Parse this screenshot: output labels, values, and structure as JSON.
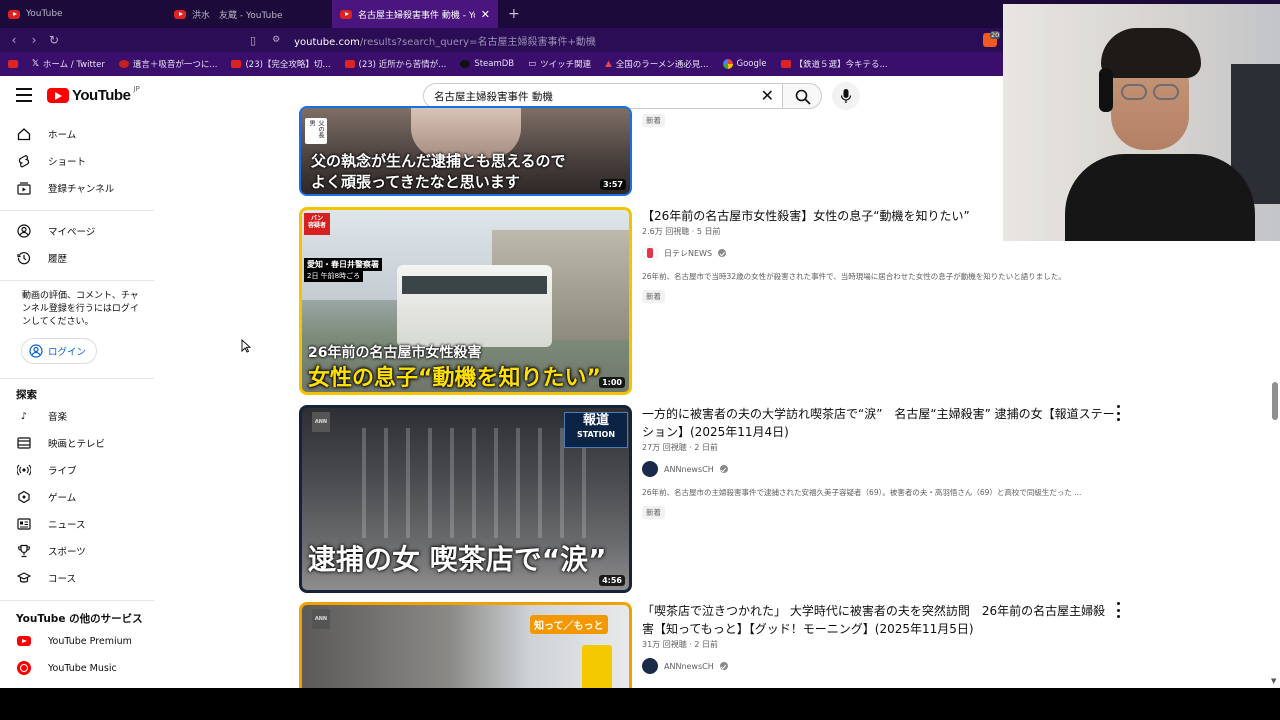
{
  "browser": {
    "tabs": [
      {
        "title": "YouTube",
        "active": false
      },
      {
        "title": "洪水　友蔵 - YouTube",
        "active": false
      },
      {
        "title": "名古屋主婦殺害事件 動機 - YouT",
        "active": true
      }
    ],
    "url_host": "youtube.com",
    "url_path": "/results?search_query=名古屋主婦殺害事件+動機",
    "bookmarks": [
      "ホーム / Twitter",
      "遺言＋吸音が一つに...",
      "(23)【完全攻略】切...",
      "(23) 近所から苦情が...",
      "SteamDB",
      "ツイッチ関連",
      "全国のラーメン通必見...",
      "Google",
      "【鉄道５選】今キテる..."
    ],
    "shield_count": "20"
  },
  "youtube": {
    "logo_text": "YouTube",
    "logo_region": "JP",
    "search_value": "名古屋主婦殺害事件 動機"
  },
  "sidebar": {
    "main": [
      "ホーム",
      "ショート",
      "登録チャンネル"
    ],
    "you": [
      "マイページ",
      "履歴"
    ],
    "login_note": "動画の評価、コメント、チャンネル登録を行うにはログインしてください。",
    "login_label": "ログイン",
    "explore_heading": "探索",
    "explore": [
      "音楽",
      "映画とテレビ",
      "ライブ",
      "ゲーム",
      "ニュース",
      "スポーツ",
      "コース"
    ],
    "more_heading": "YouTube の他のサービス",
    "more": [
      "YouTube Premium",
      "YouTube Music"
    ]
  },
  "results": [
    {
      "duration": "3:57",
      "thumb_caption_small": "父の長男",
      "thumb_caption_1": "父の執念が生んだ逮捕とも思えるので",
      "thumb_caption_2": "よく頑張ってきたなと思います",
      "badge": "新着"
    },
    {
      "title": "【26年前の名古屋市女性殺害】女性の息子“動機を知りたい”",
      "views": "2.6万 回視聴",
      "age": "5 日前",
      "channel": "日テレNEWS",
      "description": "26年前、名古屋市で当時32歳の女性が殺害された事件で、当時現場に居合わせた女性の息子が動機を知りたいと語りました。",
      "badge": "新着",
      "duration": "1:00",
      "thumb_tag": "バン\n容疑者",
      "thumb_place": "愛知・春日井警察署",
      "thumb_time": "2日 午前8時ごろ",
      "thumb_headline_1": "26年前の名古屋市女性殺害",
      "thumb_headline_2": "女性の息子“動機を知りたい”"
    },
    {
      "title": "一方的に被害者の夫の大学訪れ喫茶店で“涙”　名古屋“主婦殺害” 逮捕の女【報道ステーション】(2025年11月4日)",
      "views": "27万 回視聴",
      "age": "2 日前",
      "channel": "ANNnewsCH",
      "description": "26年前、名古屋市の主婦殺害事件で逮捕された安福久美子容疑者（69）。被害者の夫・高羽悟さん（69）と高校で同級生だった ...",
      "badge": "新着",
      "duration": "4:56",
      "thumb_logo_1": "報道",
      "thumb_logo_2": "STATION",
      "thumb_headline": "逮捕の女 喫茶店で“涙”"
    },
    {
      "title": "「喫茶店で泣きつかれた」 大学時代に被害者の夫を突然訪問　26年前の名古屋主婦殺害【知ってもっと】【グッド！モーニング】(2025年11月5日)",
      "views": "31万 回視聴",
      "age": "2 日前",
      "channel": "ANNnewsCH",
      "thumb_tag": "知って／もっと"
    }
  ]
}
